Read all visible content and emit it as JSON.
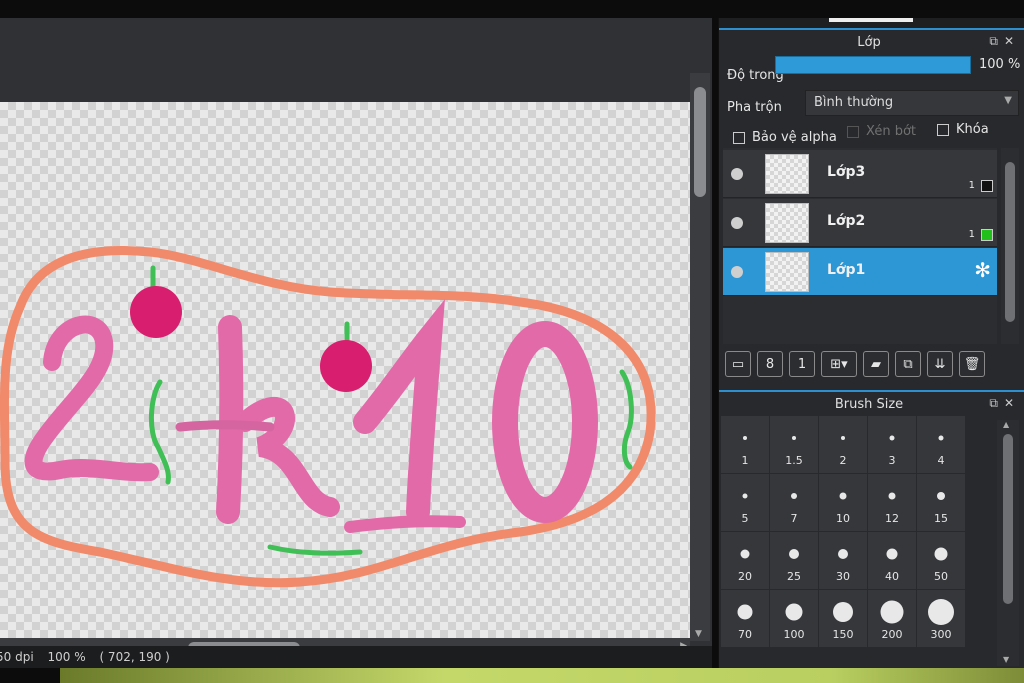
{
  "status_bar": {
    "dpi": "50 dpi",
    "zoom": "100 %",
    "coords": "( 702, 190 )"
  },
  "layer_panel": {
    "title": "Lớp",
    "opacity_label": "Độ trong",
    "opacity_value": "100 %",
    "opacity_fraction": 1.0,
    "blend_label": "Pha trộn",
    "blend_value": "Bình thường",
    "protect_alpha_label": "Bảo vệ alpha",
    "clipping_label": "Xén bớt",
    "lock_label": "Khóa",
    "layers": [
      {
        "name": "Lớp3",
        "num": "1",
        "swatch": "#111111"
      },
      {
        "name": "Lớp2",
        "num": "1",
        "swatch": "#22c01a"
      },
      {
        "name": "Lớp1",
        "active": true
      }
    ]
  },
  "brush_panel": {
    "title": "Brush Size",
    "sizes": [
      "1",
      "1.5",
      "2",
      "3",
      "4",
      "5",
      "7",
      "10",
      "12",
      "15",
      "20",
      "25",
      "30",
      "40",
      "50",
      "70",
      "100",
      "150",
      "200",
      "300"
    ]
  },
  "canvas_drawing": {
    "text": "2k10",
    "colors": {
      "orange": "#f08a6a",
      "pink": "#e26aa8",
      "magenta": "#d81e6e",
      "green": "#3fbf55"
    }
  }
}
